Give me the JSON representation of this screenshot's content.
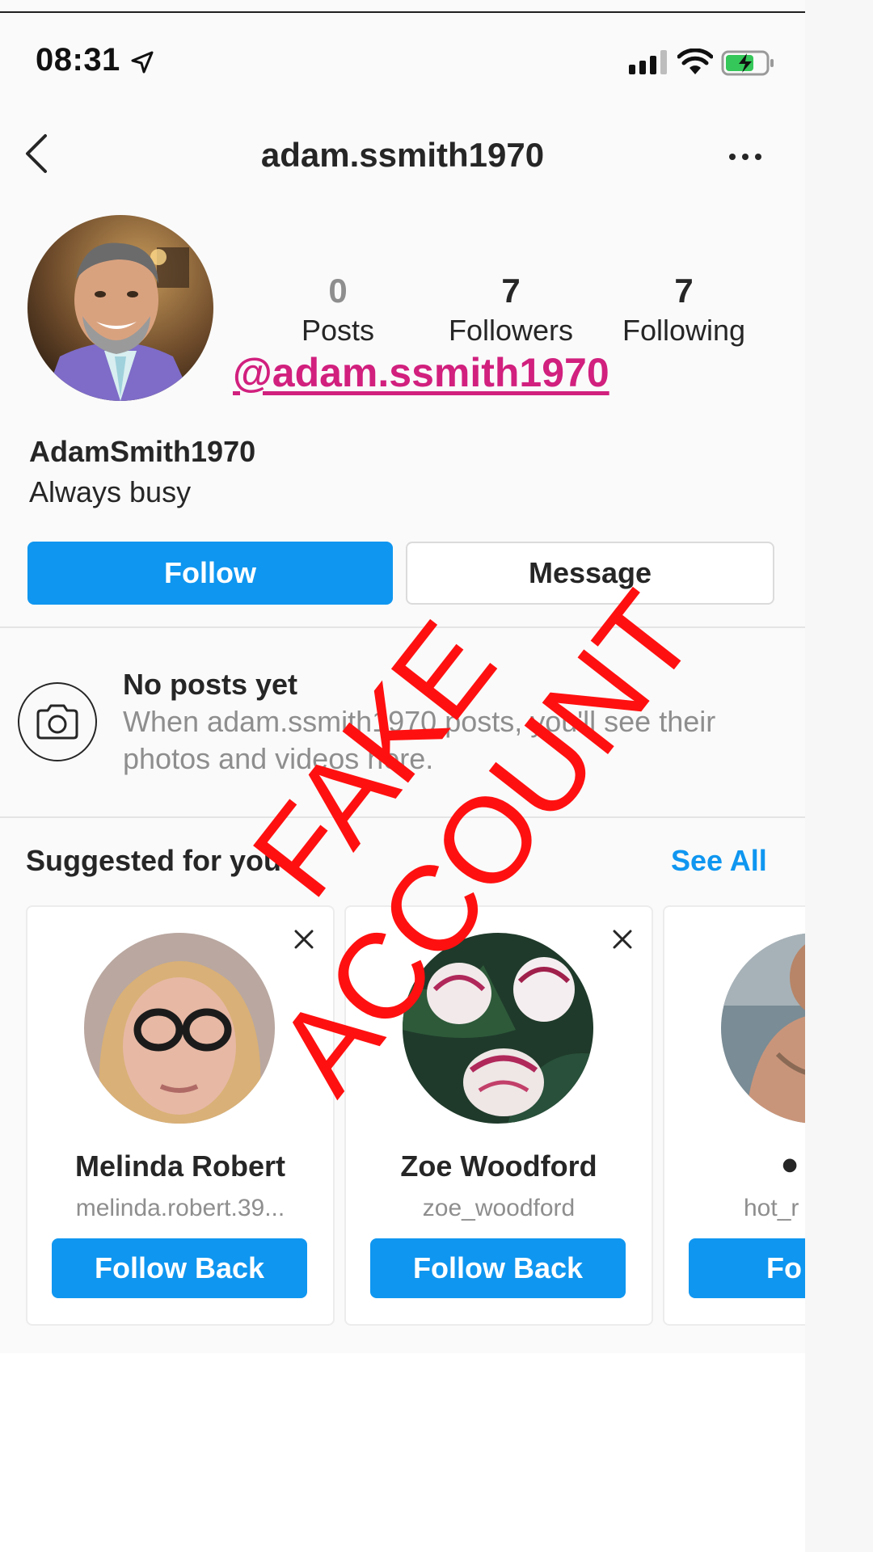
{
  "status_bar": {
    "time": "08:31"
  },
  "nav": {
    "title": "adam.ssmith1970"
  },
  "profile": {
    "stats": [
      {
        "value": "0",
        "label": "Posts"
      },
      {
        "value": "7",
        "label": "Followers"
      },
      {
        "value": "7",
        "label": "Following"
      }
    ],
    "handle_overlay": "@adam.ssmith1970",
    "full_name": "AdamSmith1970",
    "bio": "Always busy",
    "follow_label": "Follow",
    "message_label": "Message"
  },
  "empty_state": {
    "title": "No posts yet",
    "text": "When adam.ssmith1970 posts, you'll see their photos and videos here."
  },
  "suggested": {
    "title": "Suggested for you",
    "see_all": "See All",
    "cards": [
      {
        "name": "Melinda Robert",
        "username": "melinda.robert.39...",
        "button": "Follow Back"
      },
      {
        "name": "Zoe Woodford",
        "username": "zoe_woodford",
        "button": "Follow Back"
      },
      {
        "name": "⚫",
        "username": "hot_r",
        "button": "Fo"
      }
    ]
  },
  "stamp": "FAKE ACCOUNT",
  "colors": {
    "accent": "#0f96f0",
    "stamp": "#ff1010",
    "overlay_handle": "#d1207e"
  }
}
